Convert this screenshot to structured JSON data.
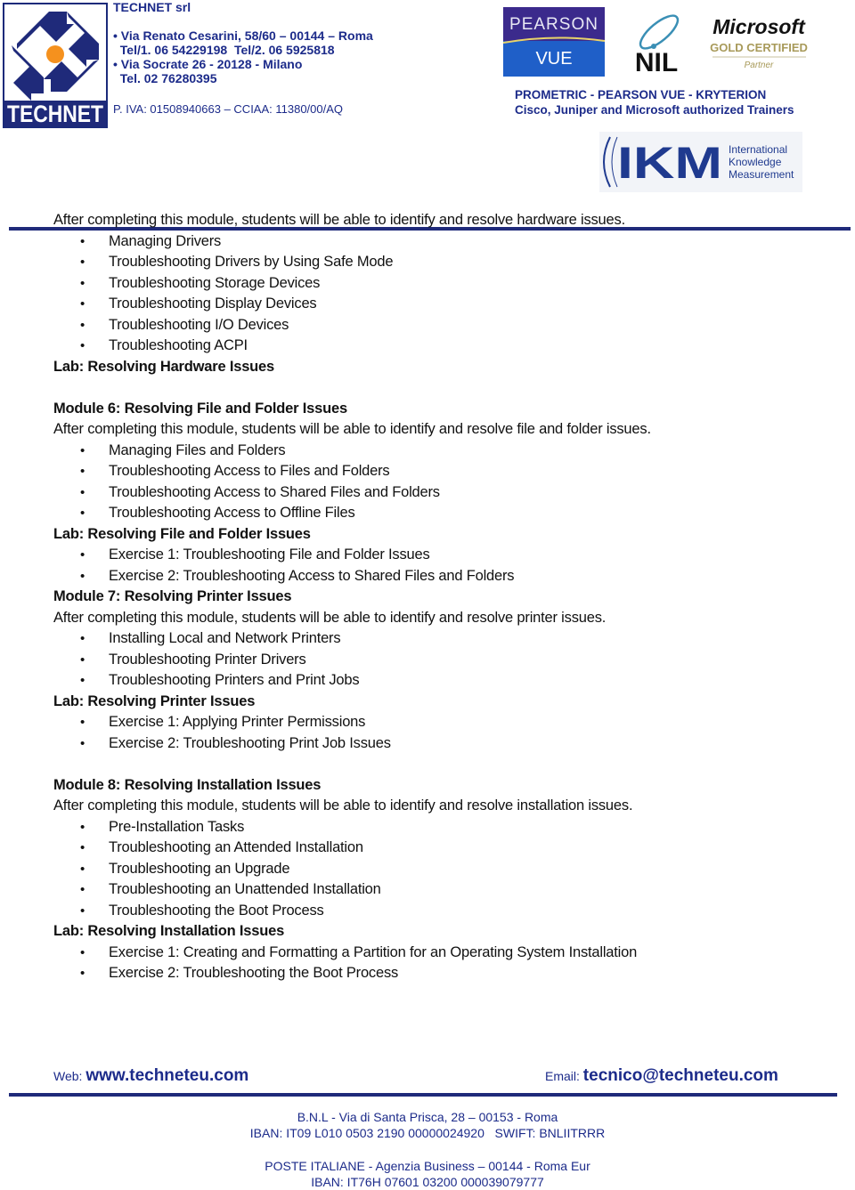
{
  "header": {
    "company_name": "TECHNET srl",
    "logo_text": "TECHNET",
    "address_lines": [
      "• Via Renato Cesarini, 58/60 – 00144 – Roma",
      "  Tel/1. 06 54229198  Tel/2. 06 5925818",
      "• Via Socrate 26 - 20128 - Milano",
      "  Tel. 02 76280395"
    ],
    "piva": "P. IVA: 01508940663 – CCIAA: 11380/00/AQ",
    "partners": {
      "pearson_top": "PEARSON",
      "pearson_bottom": "VUE",
      "nil": "NIL",
      "ms_top": "Microsoft",
      "ms_mid": "GOLD CERTIFIED",
      "ms_bottom": "Partner",
      "ikm": "IKM",
      "ikm_sub": [
        "International",
        "Knowledge",
        "Measurement"
      ]
    },
    "prometric_line": "PROMETRIC - PEARSON VUE - KRYTERION",
    "trainers_line": "Cisco, Juniper and  Microsoft authorized Trainers"
  },
  "content": {
    "intro_m5": "After completing this module, students will be able to identify and resolve hardware issues.",
    "m5_items": [
      "Managing Drivers",
      "Troubleshooting Drivers by Using Safe Mode",
      "Troubleshooting Storage Devices",
      "Troubleshooting Display Devices",
      "Troubleshooting I/O Devices",
      "Troubleshooting ACPI"
    ],
    "m5_lab": "Lab: Resolving Hardware Issues",
    "m6_title": "Module 6: Resolving File and Folder Issues",
    "m6_intro": "After completing this module, students will be able to identify and resolve file and folder issues.",
    "m6_items": [
      "Managing Files and Folders",
      "Troubleshooting Access to Files and Folders",
      "Troubleshooting Access to Shared Files and Folders",
      "Troubleshooting Access to Offline Files"
    ],
    "m6_lab": "Lab: Resolving File and Folder Issues",
    "m6_lab_items": [
      "Exercise 1: Troubleshooting File and Folder Issues",
      "Exercise 2: Troubleshooting Access to Shared Files and Folders"
    ],
    "m7_title": "Module 7: Resolving Printer Issues",
    "m7_intro": "After completing this module, students will be able to identify and resolve printer issues.",
    "m7_items": [
      "Installing Local and Network Printers",
      "Troubleshooting Printer Drivers",
      "Troubleshooting Printers and Print Jobs"
    ],
    "m7_lab": "Lab: Resolving Printer Issues",
    "m7_lab_items": [
      "Exercise 1: Applying Printer Permissions",
      "Exercise 2: Troubleshooting Print Job Issues"
    ],
    "m8_title": "Module 8: Resolving Installation Issues",
    "m8_intro": "After completing this module, students will be able to identify and resolve installation issues.",
    "m8_items": [
      "Pre-Installation Tasks",
      "Troubleshooting an Attended Installation",
      "Troubleshooting an Upgrade",
      "Troubleshooting an Unattended Installation",
      "Troubleshooting the Boot Process"
    ],
    "m8_lab": "Lab: Resolving Installation Issues",
    "m8_lab_items": [
      "Exercise 1: Creating and Formatting a Partition for an Operating System Installation",
      "Exercise 2: Troubleshooting the Boot Process"
    ]
  },
  "footer": {
    "web_label": "Web:",
    "web_url": "www.techneteu.com",
    "email_label": "Email:",
    "email": "tecnico@techneteu.com",
    "bnl_line": "B.N.L  - Via di Santa Prisca, 28 – 00153 - Roma",
    "bnl_iban": "IBAN: IT09 L010 0503 2190 00000024920   SWIFT: BNLIITRRR",
    "poste_line": "POSTE ITALIANE - Agenzia Business – 00144 - Roma Eur",
    "poste_iban": "IBAN: IT76H 07601 03200 000039079777"
  },
  "colors": {
    "brand_blue": "#1c2b8a",
    "rule_blue": "#1f2a7a",
    "logo_orange": "#f5911e"
  }
}
